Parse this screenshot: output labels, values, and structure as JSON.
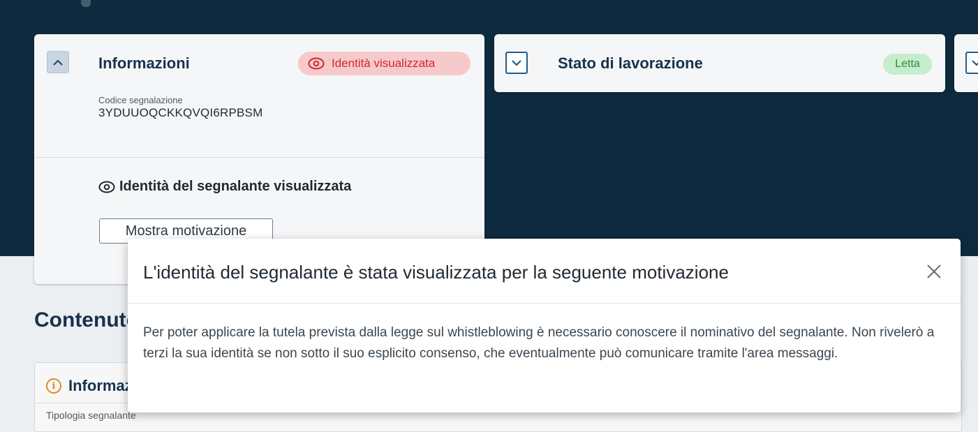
{
  "cards": {
    "info": {
      "title": "Informazioni",
      "badge": "Identità visualizzata",
      "code_label": "Codice segnalazione",
      "code_value": "3YDUUOQCKKQVQI6RPBSM",
      "identity_status": "Identità del segnalante visualizzata",
      "show_reason_button": "Mostra motivazione"
    },
    "stato": {
      "title": "Stato di lavorazione",
      "badge": "Letta"
    }
  },
  "content": {
    "section_title": "Contenuto",
    "info_box_title": "Informazioni",
    "field_label": "Tipologia segnalante"
  },
  "modal": {
    "title": "L'identità del segnalante è stata visualizzata per la seguente motivazione",
    "body": "Per poter applicare la tutela prevista dalla legge sul whistleblowing è necessario conoscere il nominativo del segnalante. Non rivelerò a terzi la sua identità se non sotto il suo esplicito consenso, che eventualmente può comunicare tramite l'area messaggi."
  },
  "colors": {
    "hero_background": "#0d2a3f",
    "primary": "#17324d",
    "danger_badge_bg": "#f6caca",
    "danger_text": "#d3262d",
    "success_badge_bg": "#c6edcc",
    "success_text": "#2e8a3e",
    "warning_icon": "#e08a1e"
  },
  "icons": {
    "collapse": "chevron-up-icon",
    "expand": "chevron-down-icon",
    "eye": "eye-icon",
    "info": "info-circle-icon",
    "close": "close-icon"
  }
}
